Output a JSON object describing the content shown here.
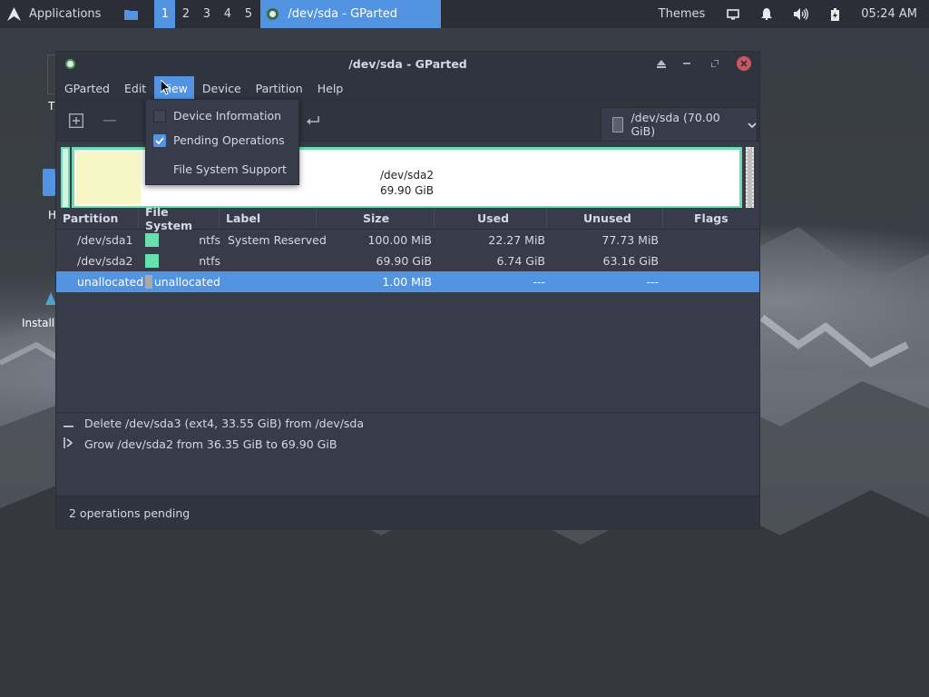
{
  "panel": {
    "applications_label": "Applications",
    "workspaces": [
      "1",
      "2",
      "3",
      "4",
      "5"
    ],
    "active_workspace": "1",
    "task_title": "/dev/sda - GParted",
    "themes_label": "Themes",
    "clock": "05:24 AM"
  },
  "desktop": {
    "icon_label_1": "T",
    "icon_label_2": "H",
    "icon_label_3": "Install"
  },
  "window": {
    "title": "/dev/sda - GParted"
  },
  "menubar": {
    "items": [
      "GParted",
      "Edit",
      "View",
      "Device",
      "Partition",
      "Help"
    ],
    "open_item": "View"
  },
  "view_menu": {
    "items": [
      {
        "label": "Device Information",
        "checkable": true,
        "checked": false
      },
      {
        "label": "Pending Operations",
        "checkable": true,
        "checked": true
      },
      {
        "label": "File System Support",
        "checkable": false,
        "checked": false
      }
    ]
  },
  "toolbar": {
    "device_selector": "/dev/sda (70.00 GiB)"
  },
  "diskmap": {
    "sda2_name": "/dev/sda2",
    "sda2_size": "69.90 GiB"
  },
  "table": {
    "columns": [
      "Partition",
      "File System",
      "Label",
      "Size",
      "Used",
      "Unused",
      "Flags"
    ],
    "rows": [
      {
        "partition": "/dev/sda1",
        "filesystem": "ntfs",
        "fs_color": "#67dfae",
        "label": "System Reserved",
        "size": "100.00 MiB",
        "used": "22.27 MiB",
        "unused": "77.73 MiB",
        "flags": "",
        "selected": false
      },
      {
        "partition": "/dev/sda2",
        "filesystem": "ntfs",
        "fs_color": "#67dfae",
        "label": "",
        "size": "69.90 GiB",
        "used": "6.74 GiB",
        "unused": "63.16 GiB",
        "flags": "",
        "selected": false
      },
      {
        "partition": "unallocated",
        "filesystem": "unallocated",
        "fs_color": "#a9a9a9",
        "label": "",
        "size": "1.00 MiB",
        "used": "---",
        "unused": "---",
        "flags": "",
        "selected": true
      }
    ]
  },
  "operations": [
    {
      "icon": "delete-icon",
      "text": "Delete /dev/sda3 (ext4, 33.55 GiB) from /dev/sda"
    },
    {
      "icon": "grow-icon",
      "text": "Grow /dev/sda2 from 36.35 GiB to 69.90 GiB"
    }
  ],
  "status": {
    "text": "2 operations pending"
  },
  "colors": {
    "accent": "#5294e2",
    "ntfs": "#67dfae",
    "unallocated": "#a9a9a9",
    "close": "#cc575d"
  }
}
